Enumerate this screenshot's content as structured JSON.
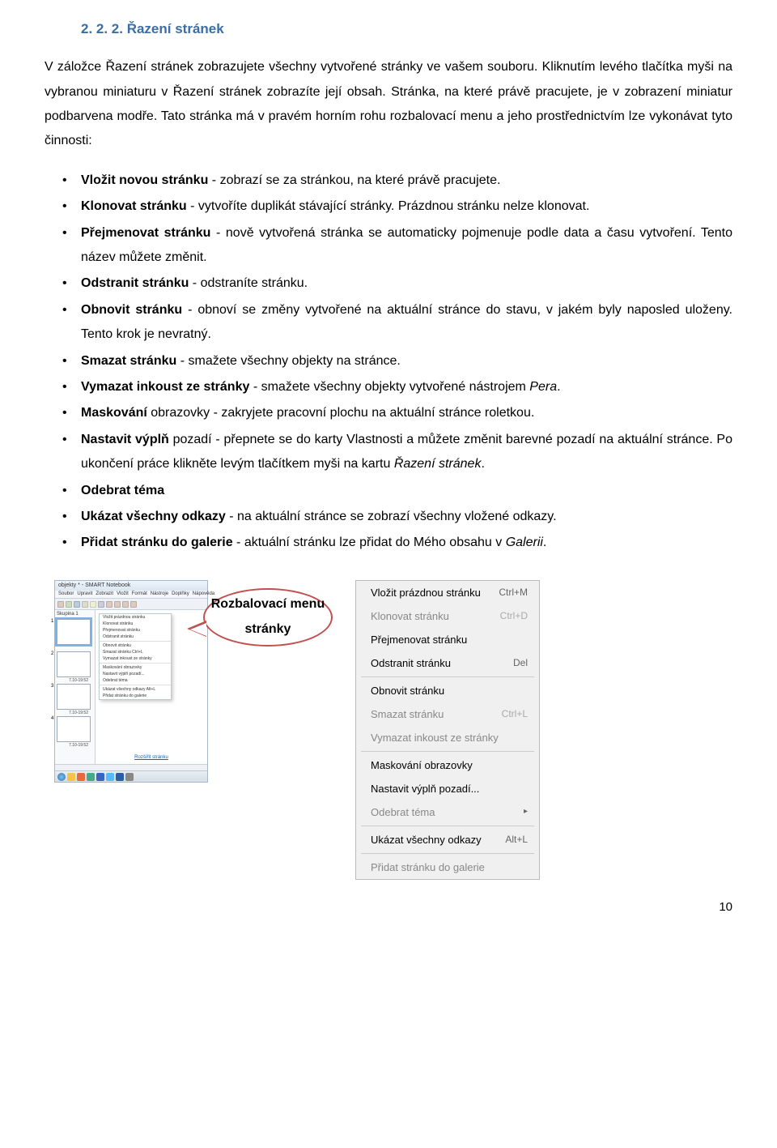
{
  "heading": "2. 2. 2. Řazení stránek",
  "intro": "V záložce Řazení stránek zobrazujete všechny vytvořené stránky ve vašem souboru. Kliknutím levého tlačítka myši na vybranou miniaturu v Řazení stránek zobrazíte její obsah. Stránka, na které právě pracujete, je v zobrazení miniatur podbarvena modře. Tato stránka má v pravém horním rohu rozbalovací menu a jeho prostřednictvím lze vykonávat tyto činnosti:",
  "items": [
    {
      "bold": "Vložit novou stránku",
      "rest": " -  zobrazí se za stránkou, na které právě pracujete."
    },
    {
      "bold": "Klonovat stránku",
      "rest": " -  vytvoříte duplikát stávající stránky. Prázdnou stránku nelze klonovat."
    },
    {
      "bold": "Přejmenovat stránku",
      "rest": "  - nově vytvořená stránka se automaticky pojmenuje podle data a času vytvoření. Tento název můžete změnit."
    },
    {
      "bold": "Odstranit stránku",
      "rest": " - odstraníte stránku."
    },
    {
      "bold": "Obnovit stránku",
      "rest": " -  obnoví se změny vytvořené na aktuální stránce do stavu, v jakém byly naposled uloženy. Tento krok je nevratný."
    },
    {
      "bold": "Smazat stránku",
      "rest": " - smažete všechny objekty na stránce."
    },
    {
      "bold": "Vymazat inkoust ze stránky",
      "rest": " - smažete všechny objekty vytvořené nástrojem ",
      "italic": "Pera",
      "tail": "."
    },
    {
      "bold": "Maskování",
      "rest": " obrazovky - zakryjete pracovní plochu na aktuální stránce roletkou."
    },
    {
      "bold": "Nastavit výplň",
      "rest": " pozadí - přepnete se do karty Vlastnosti a můžete změnit barevné pozadí na aktuální stránce. Po ukončení práce klikněte levým tlačítkem myši na kartu ",
      "italic": "Řazení stránek",
      "tail": "."
    },
    {
      "bold": "Odebrat téma",
      "rest": ""
    },
    {
      "bold": "Ukázat všechny odkazy",
      "rest": " - na aktuální stránce se zobrazí všechny vložené odkazy."
    },
    {
      "bold": "Přidat stránku do galerie",
      "rest": " - aktuální stránku lze přidat do Mého obsahu v ",
      "italic": "Galerii",
      "tail": "."
    }
  ],
  "callout": "Rozbalovací menu stránky",
  "mini": {
    "title": "objekty * - SMART Notebook",
    "menubar": [
      "Soubor",
      "Upravit",
      "Zobrazit",
      "Vložit",
      "Formát",
      "Nástroje",
      "Doplňky",
      "Nápověda"
    ],
    "ctx": [
      "Vložit prázdnou stránku",
      "Klonovat stránku",
      "Přejmenovat stránku",
      "Odstranit stránku",
      "Obnovit stránku",
      "Smazat stránku    Ctrl+L",
      "Vymazat inkoust ze stránky",
      "Maskování obrazovky",
      "Nastavit výplň pozadí...",
      "Odebrat téma",
      "Ukázat všechny odkazy    Alt+L",
      "Přidat stránku do galerie"
    ],
    "link": "Rozšířit stránku",
    "thumb_label": "Skupina 1",
    "times": [
      "",
      "7.10-19:52",
      "7.10-19:52",
      "7.10-19:52"
    ]
  },
  "menu": [
    {
      "label": "Vložit prázdnou stránku",
      "shortcut": "Ctrl+M",
      "disabled": false
    },
    {
      "label": "Klonovat stránku",
      "shortcut": "Ctrl+D",
      "disabled": true
    },
    {
      "label": "Přejmenovat stránku",
      "shortcut": "",
      "disabled": false
    },
    {
      "label": "Odstranit stránku",
      "shortcut": "Del",
      "disabled": false
    },
    {
      "sep": true
    },
    {
      "label": "Obnovit stránku",
      "shortcut": "",
      "disabled": false
    },
    {
      "label": "Smazat stránku",
      "shortcut": "Ctrl+L",
      "disabled": true
    },
    {
      "label": "Vymazat inkoust ze stránky",
      "shortcut": "",
      "disabled": true
    },
    {
      "sep": true
    },
    {
      "label": "Maskování obrazovky",
      "shortcut": "",
      "disabled": false
    },
    {
      "label": "Nastavit výplň pozadí...",
      "shortcut": "",
      "disabled": false,
      "arrow": false
    },
    {
      "label": "Odebrat téma",
      "shortcut": "",
      "disabled": true,
      "arrow": true
    },
    {
      "sep": true
    },
    {
      "label": "Ukázat všechny odkazy",
      "shortcut": "Alt+L",
      "disabled": false
    },
    {
      "sep": true
    },
    {
      "label": "Přidat stránku do galerie",
      "shortcut": "",
      "disabled": true
    }
  ],
  "page_number": "10"
}
